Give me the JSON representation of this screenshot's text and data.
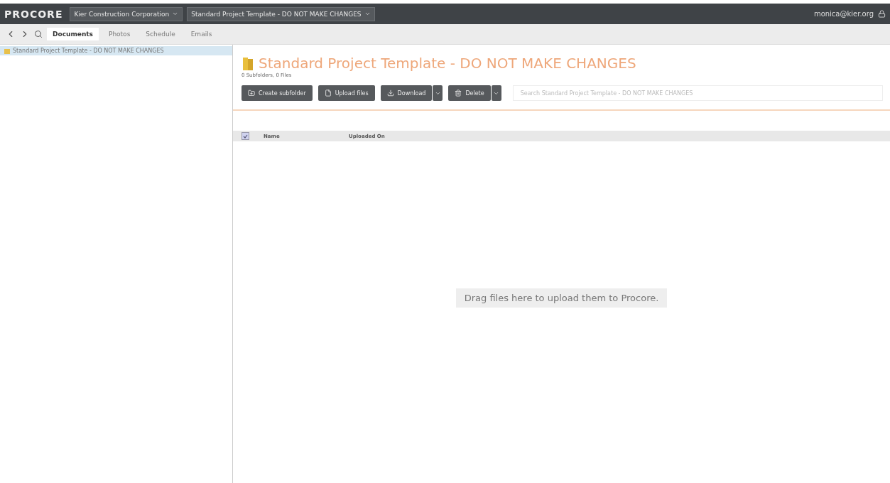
{
  "top_bar": {
    "logo": "PROCORE",
    "company": "Kier Construction Corporation",
    "project": "Standard Project Template - DO NOT MAKE CHANGES",
    "user": "monica@kier.org"
  },
  "tabs": [
    {
      "label": "Documents",
      "selected": true
    },
    {
      "label": "Photos",
      "selected": false
    },
    {
      "label": "Schedule",
      "selected": false
    },
    {
      "label": "Emails",
      "selected": false
    }
  ],
  "sidebar": {
    "items": [
      {
        "label": "Standard Project Template - DO NOT MAKE CHANGES",
        "selected": true
      }
    ]
  },
  "folder": {
    "title": "Standard Project Template - DO NOT MAKE CHANGES",
    "summary": "0 Subfolders, 0 Files"
  },
  "toolbar": {
    "buttons": [
      {
        "label": "Create subfolder",
        "kind": "folder",
        "split": false
      },
      {
        "label": "Upload files",
        "kind": "file",
        "split": false
      },
      {
        "label": "Download",
        "kind": "download",
        "split": true
      },
      {
        "label": "Delete",
        "kind": "trash",
        "split": true
      }
    ],
    "search": {
      "placeholder": "Search Standard Project Template - DO NOT MAKE CHANGES"
    }
  },
  "table": {
    "select_all": {
      "checked": true
    },
    "columns": [
      "Name",
      "Uploaded On"
    ]
  },
  "drop_zone": {
    "text": "Drag files here to upload them to Procore."
  }
}
